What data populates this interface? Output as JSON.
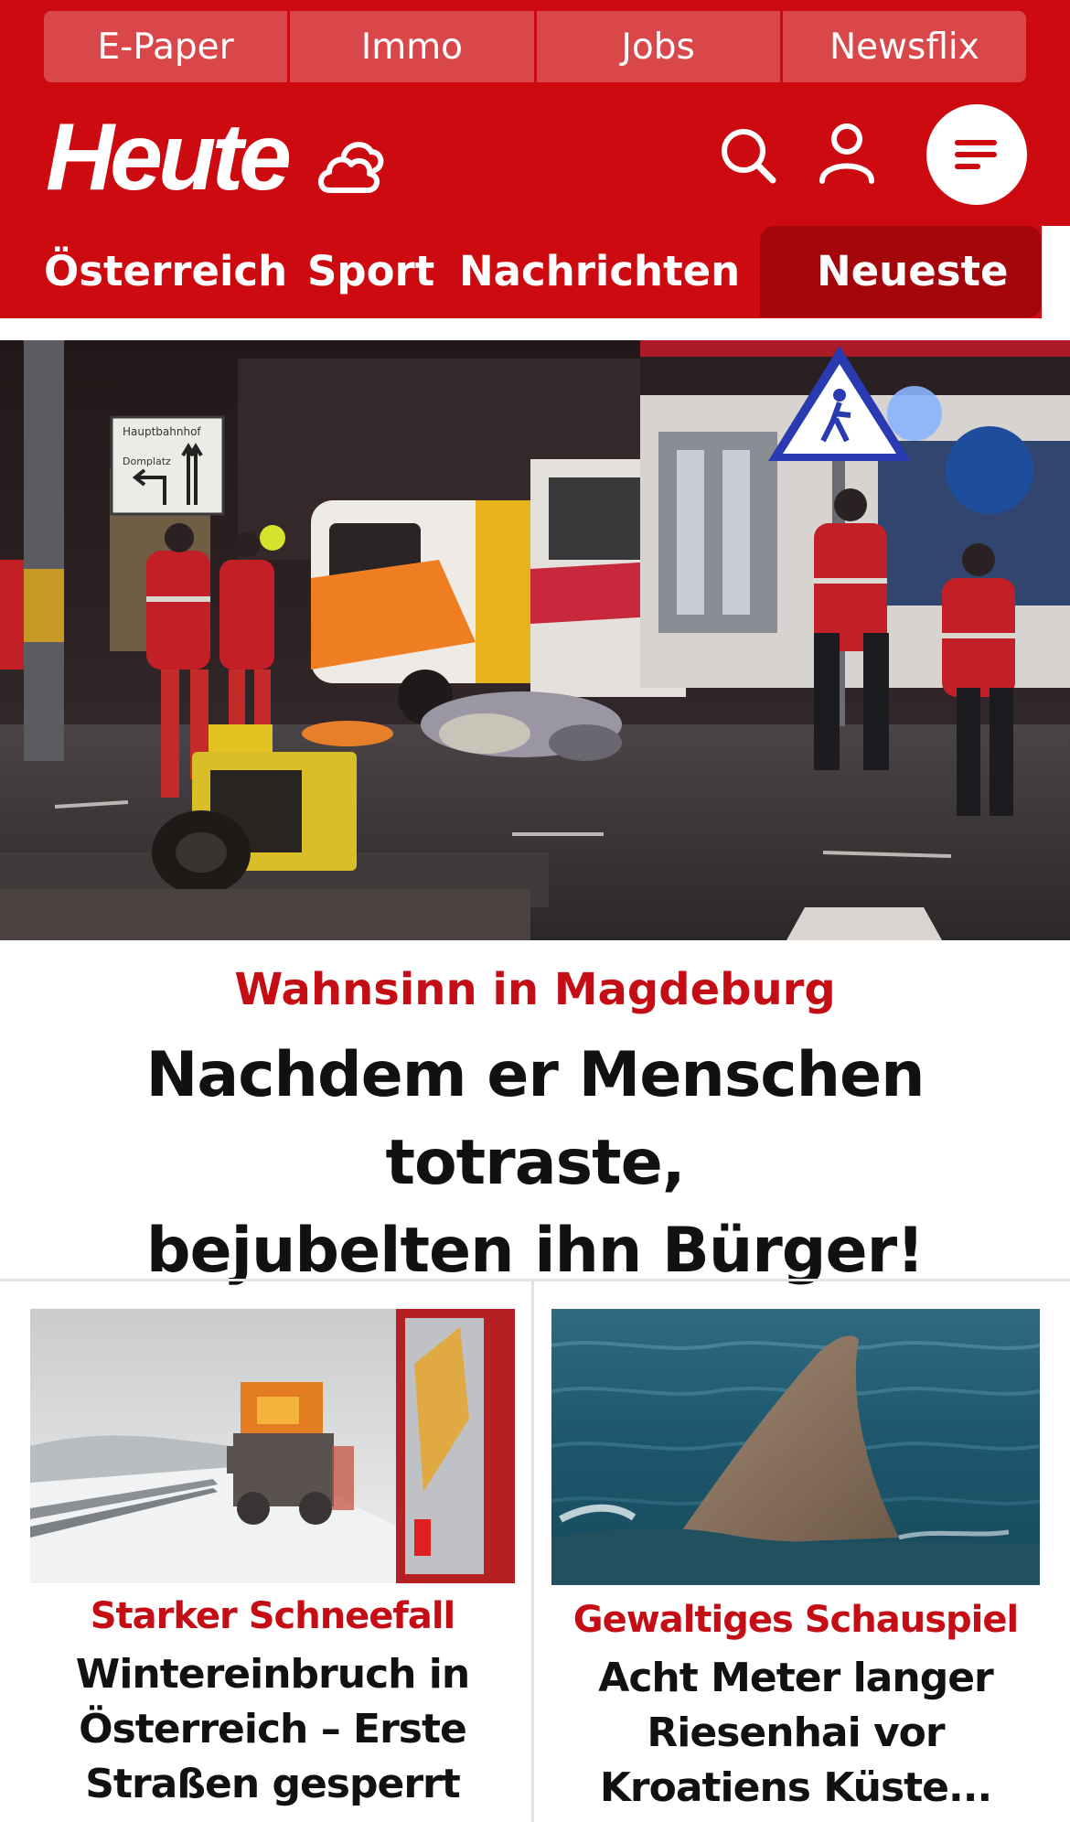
{
  "topbar": {
    "items": [
      "E-Paper",
      "Immo",
      "Jobs",
      "Newsflix"
    ]
  },
  "brand": {
    "logo_text": "Heute",
    "color": "#cc0a10",
    "active_tab_color": "#a5060c",
    "kicker_color": "#c40d14"
  },
  "icons": {
    "weather": "weather-cloud-icon",
    "search": "search-icon",
    "account": "account-icon",
    "menu": "hamburger-menu-icon"
  },
  "nav": {
    "items": [
      "Österreich",
      "Sport",
      "Nachrichten"
    ],
    "active": "Neueste"
  },
  "hero": {
    "image": "Nighttime emergency scene with rescue workers and ambulances",
    "sign_text": [
      "Hauptbahnhof",
      "Domplatz"
    ],
    "kicker": "Wahnsinn in Magdeburg",
    "title_lines": [
      "Nachdem er Menschen totraste,",
      "bejubelten ihn Bürger!"
    ]
  },
  "cards": [
    {
      "image": "Snow plow on a snowy highway",
      "kicker": "Starker Schneefall",
      "title_lines": [
        "Wintereinbruch in",
        "Österreich – Erste",
        "Straßen gesperrt"
      ]
    },
    {
      "image": "Shark fin above the sea surface",
      "kicker": "Gewaltiges Schauspiel",
      "title_lines": [
        "Acht Meter langer",
        "Riesenhai vor",
        "Kroatiens Küste..."
      ]
    }
  ]
}
